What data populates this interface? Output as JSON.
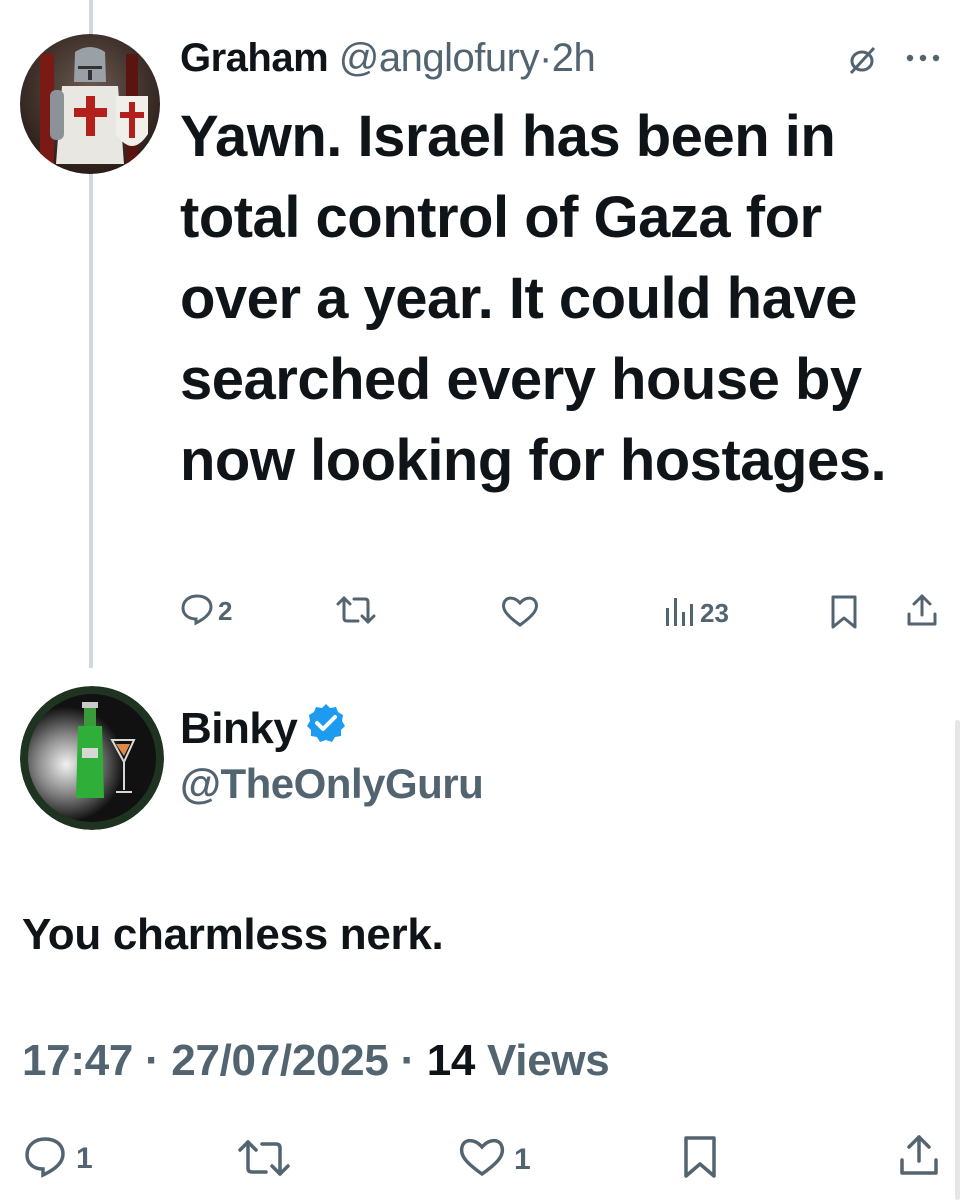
{
  "parent_tweet": {
    "display_name": "Graham",
    "handle": "@anglofury",
    "separator": "·",
    "time_ago": "2h",
    "text": "Yawn. Israel has been in total control of Gaza for over a year. It could have searched every house by now looking for hostages.",
    "actions": {
      "reply_count": "2",
      "retweet_count": "",
      "like_count": "",
      "views_count": "23"
    }
  },
  "reply_tweet": {
    "display_name": "Binky",
    "handle": "@TheOnlyGuru",
    "text": "You charmless nerk.",
    "time": "17:47",
    "separator": "·",
    "date": "27/07/2025",
    "views_count": "14",
    "views_label": "Views",
    "actions": {
      "reply_count": "1",
      "retweet_count": "",
      "like_count": "1"
    }
  },
  "colors": {
    "text": "#0f1419",
    "muted": "#536471",
    "verified": "#1d9bf0",
    "thread_line": "#cfd9de"
  },
  "icons": [
    "mute-conversation-icon",
    "more-icon",
    "reply-icon",
    "retweet-icon",
    "like-icon",
    "views-icon",
    "bookmark-icon",
    "share-icon",
    "verified-badge-icon"
  ]
}
